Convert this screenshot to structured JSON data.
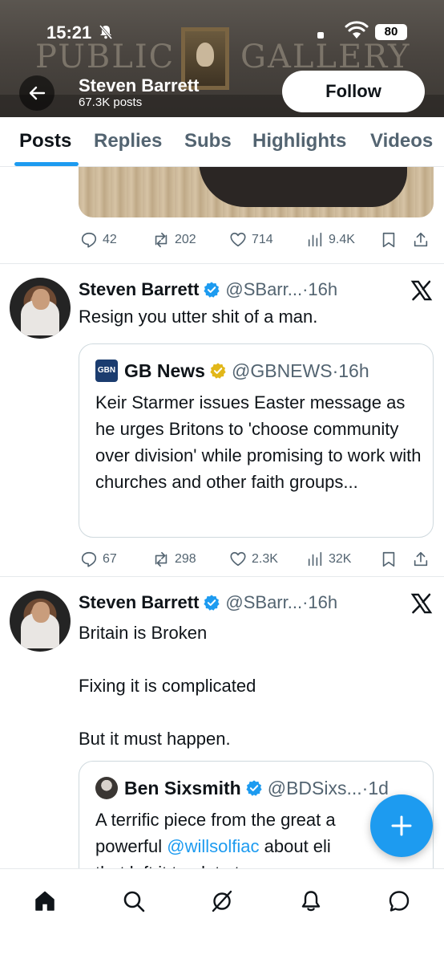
{
  "status": {
    "time": "15:21",
    "battery": "80"
  },
  "banner": {
    "left_text": "PUBLIC",
    "right_text": "GALLERY"
  },
  "profile": {
    "name": "Steven Barrett",
    "posts": "67.3K posts",
    "follow_label": "Follow"
  },
  "tabs": [
    {
      "label": "Posts",
      "active": true
    },
    {
      "label": "Replies",
      "active": false
    },
    {
      "label": "Subs",
      "active": false
    },
    {
      "label": "Highlights",
      "active": false
    },
    {
      "label": "Videos",
      "active": false
    }
  ],
  "previous_post": {
    "stats": {
      "replies": "42",
      "reposts": "202",
      "likes": "714",
      "views": "9.4K"
    }
  },
  "tweets": [
    {
      "author": "Steven Barrett",
      "handle": "@SBarr...",
      "time": "16h",
      "text": "Resign you utter shit of a man.",
      "quote": {
        "author": "GB News",
        "logo_text": "GB​N",
        "handle": "@GBNEWS",
        "time": "16h",
        "text": "Keir Starmer issues Easter message as he urges Britons to 'choose community over division' while promising to work with churches and other faith groups..."
      },
      "stats": {
        "replies": "67",
        "reposts": "298",
        "likes": "2.3K",
        "views": "32K"
      }
    },
    {
      "author": "Steven Barrett",
      "handle": "@SBarr...",
      "time": "16h",
      "text_lines": [
        "Britain is Broken",
        "Fixing it is complicated",
        "But it must happen."
      ],
      "quote": {
        "author": "Ben Sixsmith",
        "handle": "@BDSixs...",
        "time": "1d",
        "text_before": "A terrific piece from the great a",
        "text_line2_before": "powerful ",
        "mention": "@willsolfiac",
        "text_line2_after": " about eli",
        "text_line3": "that left it too late to see sense"
      }
    }
  ],
  "separator": "·",
  "colors": {
    "accent": "#1d9bf0",
    "text": "#0f1419",
    "secondary": "#536471",
    "verified": "#1d9bf0",
    "gold_verified": "#e2b719"
  },
  "nav": [
    "home-icon",
    "search-icon",
    "grok-icon",
    "notifications-icon",
    "messages-icon"
  ]
}
